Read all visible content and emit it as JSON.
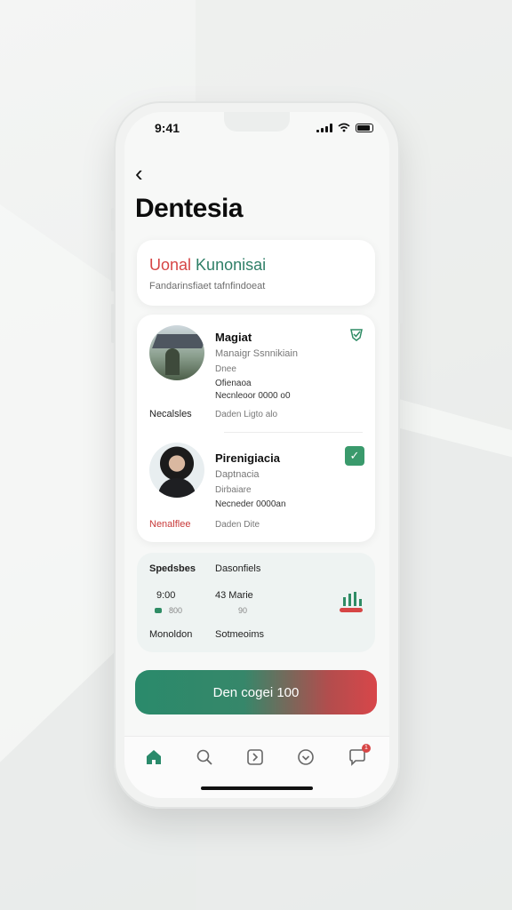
{
  "status": {
    "time": "9:41"
  },
  "header": {
    "title": "Dentesia"
  },
  "intro_card": {
    "title_red": "Uonal",
    "title_green": "Kunonisai",
    "subtitle": "Fandarinsfiaet tafnfindoeat"
  },
  "people": [
    {
      "name": "Magiat",
      "role": "Manaigr Ssnnikiain",
      "line1": "Dnee",
      "line2": "Ofienaoa",
      "line3": "Necnleoor 0000 o0",
      "footer_label": "Necalsles",
      "footer_meta": "Daden  Ligto  alo"
    },
    {
      "name": "Pirenigiacia",
      "role": "Daptnacia",
      "line1": "Dirbaiare",
      "line2": "Necneder 0000an",
      "footer_label": "Nenalflee",
      "footer_meta": "Daden  Dite"
    }
  ],
  "stats": {
    "head_left": "Spedsbes",
    "head_right": "Dasonfiels",
    "val_left": "9:00",
    "val_right": "43 Marie",
    "sub_left": "800",
    "sub_right": "90",
    "foot_left": "Monoldon",
    "foot_right": "Sotmeoims"
  },
  "cta": {
    "label": "Den cogei 100"
  },
  "tabbar": {
    "items": [
      "home",
      "search",
      "tasks",
      "favorites",
      "messages"
    ],
    "messages_badge": "1"
  },
  "colors": {
    "accent_green": "#2f7f67",
    "accent_red": "#d64545"
  }
}
